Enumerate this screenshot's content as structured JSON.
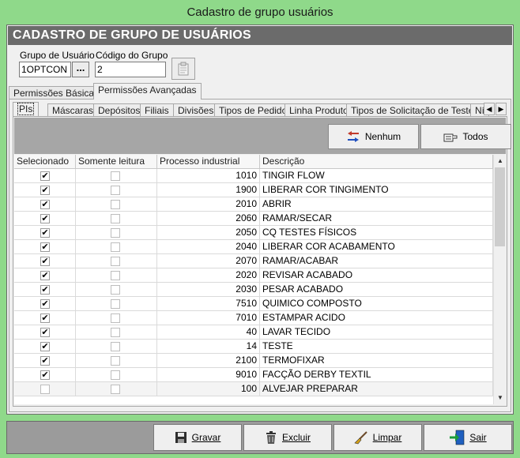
{
  "window": {
    "title": "Cadastro de grupo usuários"
  },
  "header": {
    "title": "CADASTRO DE GRUPO DE USUÁRIOS"
  },
  "form": {
    "grupo_label": "Grupo de Usuário",
    "grupo_value": "1OPTCON",
    "lookup_label": "...",
    "codigo_label": "Código do Grupo",
    "codigo_value": "2"
  },
  "outer_tabs": [
    {
      "label": "Permissões Básicas",
      "active": false
    },
    {
      "label": "Permissões Avançadas",
      "active": true
    }
  ],
  "inner_tabs": [
    {
      "label": "PIs",
      "active": true
    },
    {
      "label": "Máscaras"
    },
    {
      "label": "Depósitos"
    },
    {
      "label": "Filiais"
    },
    {
      "label": "Divisões"
    },
    {
      "label": "Tipos de Pedido"
    },
    {
      "label": "Linha Produto"
    },
    {
      "label": "Tipos de Solicitação de Testes"
    },
    {
      "label": "Ní"
    }
  ],
  "actions": {
    "none_label": "Nenhum",
    "all_label": "Todos"
  },
  "grid": {
    "columns": [
      "Selecionado",
      "Somente leitura",
      "Processo industrial",
      "Descrição"
    ],
    "rows": [
      {
        "selected": true,
        "readonly": false,
        "process": "1010",
        "description": "TINGIR FLOW"
      },
      {
        "selected": true,
        "readonly": false,
        "process": "1900",
        "description": "LIBERAR COR TINGIMENTO"
      },
      {
        "selected": true,
        "readonly": false,
        "process": "2010",
        "description": "ABRIR"
      },
      {
        "selected": true,
        "readonly": false,
        "process": "2060",
        "description": "RAMAR/SECAR"
      },
      {
        "selected": true,
        "readonly": false,
        "process": "2050",
        "description": "CQ TESTES FÍSICOS"
      },
      {
        "selected": true,
        "readonly": false,
        "process": "2040",
        "description": "LIBERAR COR ACABAMENTO"
      },
      {
        "selected": true,
        "readonly": false,
        "process": "2070",
        "description": "RAMAR/ACABAR"
      },
      {
        "selected": true,
        "readonly": false,
        "process": "2020",
        "description": "REVISAR ACABADO"
      },
      {
        "selected": true,
        "readonly": false,
        "process": "2030",
        "description": "PESAR ACABADO"
      },
      {
        "selected": true,
        "readonly": false,
        "process": "7510",
        "description": "QUIMICO COMPOSTO"
      },
      {
        "selected": true,
        "readonly": false,
        "process": "7010",
        "description": "ESTAMPAR ACIDO"
      },
      {
        "selected": true,
        "readonly": false,
        "process": "40",
        "description": "LAVAR TECIDO"
      },
      {
        "selected": true,
        "readonly": false,
        "process": "14",
        "description": "TESTE"
      },
      {
        "selected": true,
        "readonly": false,
        "process": "2100",
        "description": "TERMOFIXAR"
      },
      {
        "selected": true,
        "readonly": false,
        "process": "9010",
        "description": "FACÇÃO DERBY TEXTIL"
      },
      {
        "selected": false,
        "readonly": false,
        "process": "100",
        "description": "ALVEJAR PREPARAR"
      }
    ]
  },
  "footer": {
    "save_label": "Gravar",
    "delete_label": "Excluir",
    "clear_label": "Limpar",
    "exit_label": "Sair"
  },
  "icons": {
    "lookup_action": "clipboard-icon",
    "none": "arrows-swap-icon",
    "all": "hand-pointer-icon",
    "save": "floppy-disk-icon",
    "delete": "trash-icon",
    "clear": "brush-icon",
    "exit": "exit-door-icon"
  },
  "colors": {
    "frame": "#8fd98a",
    "header_bg": "#6b6b6b",
    "strip_bg": "#a6a6a6"
  }
}
